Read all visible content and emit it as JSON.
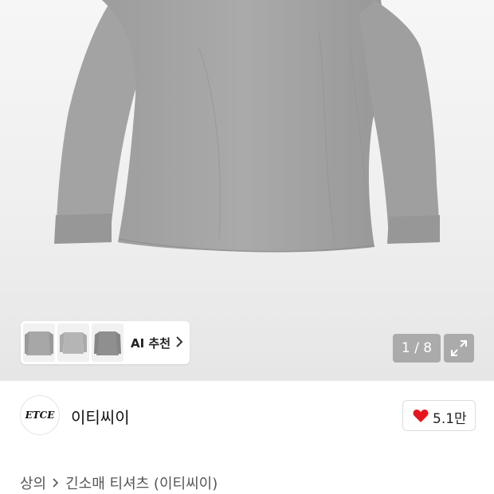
{
  "product_gallery": {
    "image_alt": "long-sleeve grey t-shirt",
    "counter": "1 / 8"
  },
  "ai_recommend": {
    "label": "AI 추천"
  },
  "brand": {
    "logo_text": "ETCE",
    "name": "이티씨이"
  },
  "like": {
    "count": "5.1만",
    "color": "#e8141b"
  },
  "breadcrumb": {
    "category": "상의",
    "subcategory": "긴소매 티셔츠 (이티씨이)"
  }
}
